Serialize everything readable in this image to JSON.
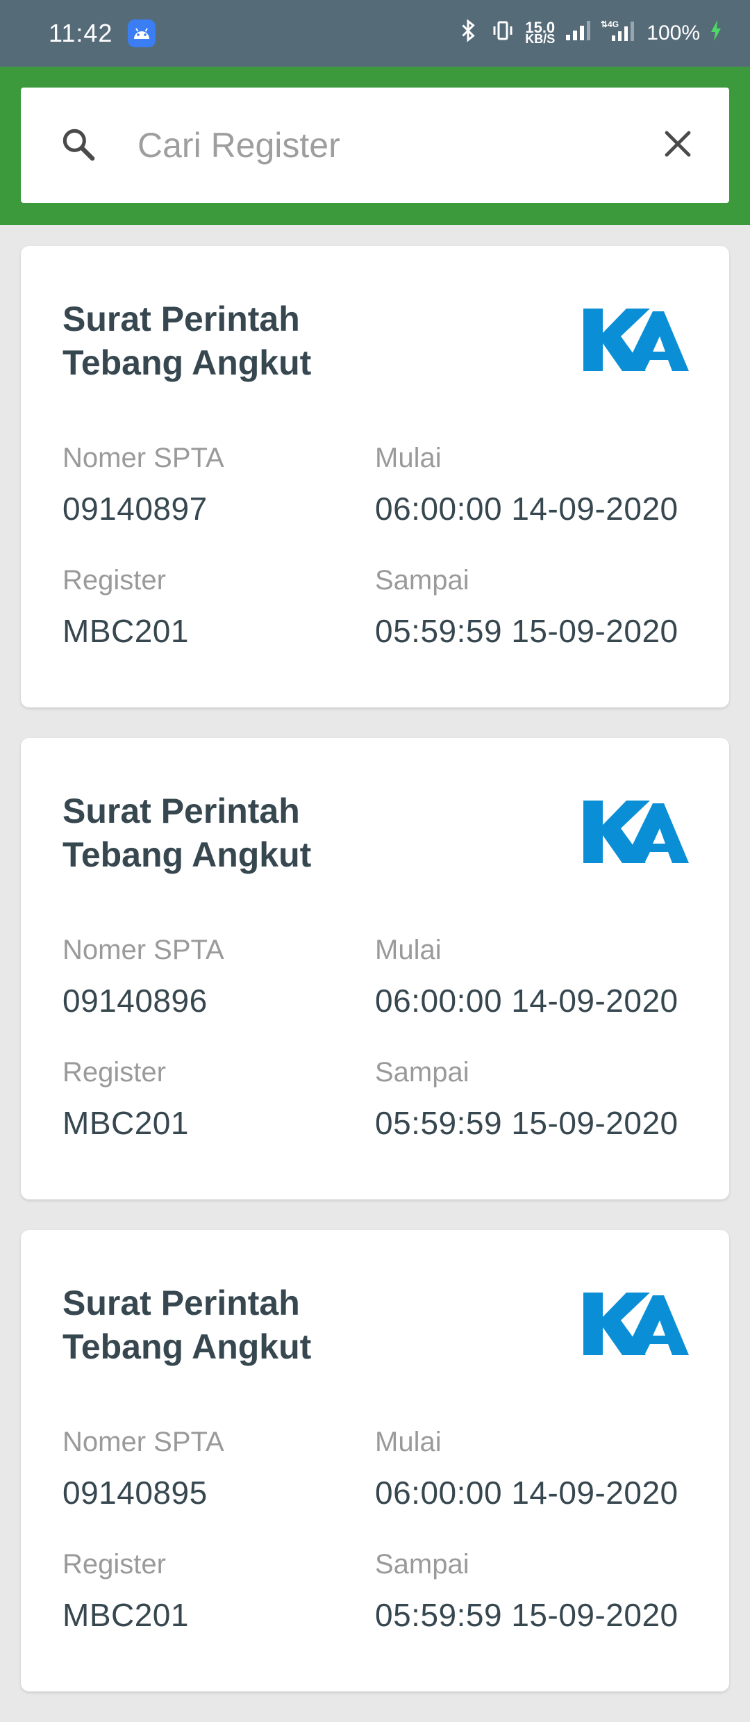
{
  "status_bar": {
    "time": "11:42",
    "net_speed_value": "15.0",
    "net_speed_unit": "KB/S",
    "battery": "100%",
    "icons": [
      "android-icon",
      "bluetooth-icon",
      "vibrate-icon",
      "signal-icon",
      "4g-signal-icon",
      "charging-icon"
    ]
  },
  "search": {
    "placeholder": "Cari Register",
    "value": ""
  },
  "colors": {
    "header": "#3c9a3c",
    "status_bar": "#566b78",
    "logo": "#0a8fd6",
    "title_text": "#37474f"
  },
  "cards": [
    {
      "title": "Surat Perintah Tebang Angkut",
      "nomer_label": "Nomer SPTA",
      "nomer_value": "09140897",
      "mulai_label": "Mulai",
      "mulai_value": "06:00:00 14-09-2020",
      "register_label": "Register",
      "register_value": "MBC201",
      "sampai_label": "Sampai",
      "sampai_value": "05:59:59 15-09-2020"
    },
    {
      "title": "Surat Perintah Tebang Angkut",
      "nomer_label": "Nomer SPTA",
      "nomer_value": "09140896",
      "mulai_label": "Mulai",
      "mulai_value": "06:00:00 14-09-2020",
      "register_label": "Register",
      "register_value": "MBC201",
      "sampai_label": "Sampai",
      "sampai_value": "05:59:59 15-09-2020"
    },
    {
      "title": "Surat Perintah Tebang Angkut",
      "nomer_label": "Nomer SPTA",
      "nomer_value": "09140895",
      "mulai_label": "Mulai",
      "mulai_value": "06:00:00 14-09-2020",
      "register_label": "Register",
      "register_value": "MBC201",
      "sampai_label": "Sampai",
      "sampai_value": "05:59:59 15-09-2020"
    }
  ]
}
